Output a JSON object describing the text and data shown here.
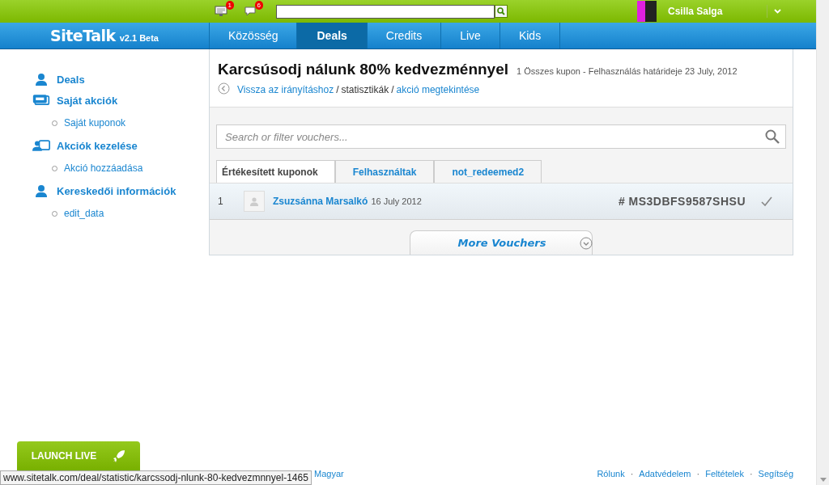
{
  "topbar": {
    "notifications": [
      {
        "kind": "monitor",
        "badge": "1"
      },
      {
        "kind": "chat",
        "badge": "6"
      }
    ],
    "user": {
      "name": "Csilla Salga"
    }
  },
  "nav": {
    "logo": "SiteTalk",
    "version": "v2.1 Beta",
    "tabs": [
      {
        "label": "Közösség",
        "selected": false
      },
      {
        "label": "Deals",
        "selected": true
      },
      {
        "label": "Credits",
        "selected": false
      },
      {
        "label": "Live",
        "selected": false
      },
      {
        "label": "Kids",
        "selected": false
      }
    ]
  },
  "sidebar": {
    "items": [
      {
        "label": "Deals",
        "kind": "person"
      },
      {
        "label": "Saját akciók",
        "kind": "ticket",
        "children": [
          {
            "label": "Saját kuponok"
          }
        ]
      },
      {
        "label": "Akciók kezelése",
        "kind": "tickets",
        "children": [
          {
            "label": "Akció hozzáadása"
          }
        ]
      },
      {
        "label": "Kereskedői információk",
        "kind": "person",
        "children": [
          {
            "label": "edit_data"
          }
        ]
      }
    ]
  },
  "deal": {
    "title": "Karcsúsodj nálunk 80% kedvezménnyel",
    "meta": "1 Összes kupon - Felhasználás határideje 23 July, 2012",
    "breadcrumbs": [
      {
        "label": "Vissza az irányításhoz",
        "link": true
      },
      {
        "separator": "/",
        "label": "statisztikák",
        "link": false
      },
      {
        "separator": "/",
        "label": "akció megtekintése",
        "link": true
      }
    ]
  },
  "vouchers": {
    "search": {
      "placeholder": "Search or filter vouchers..."
    },
    "tabs": [
      {
        "label": "Értékesített kuponok",
        "selected": true
      },
      {
        "label": "Felhasználtak",
        "selected": false
      },
      {
        "label": "not_redeemed2",
        "selected": false
      }
    ],
    "rows": [
      {
        "index": "1",
        "name": "Zsuzsánna Marsalkó",
        "date": "16 July 2012",
        "code": "# MS3DBFS9587SHSU",
        "checked": true
      }
    ],
    "more": "More Vouchers"
  },
  "launch": "LAUNCH LIVE",
  "footer": {
    "language": "Magyar",
    "links": [
      {
        "label": "Rólunk"
      },
      {
        "separator": "·",
        "label": "Adatvédelem"
      },
      {
        "separator": "·",
        "label": "Feltételek"
      },
      {
        "separator": "·",
        "label": "Segítség"
      }
    ]
  },
  "status_url": "www.sitetalk.com/deal/statistic/karcssodj-nlunk-80-kedvezmnnyel-1465"
}
